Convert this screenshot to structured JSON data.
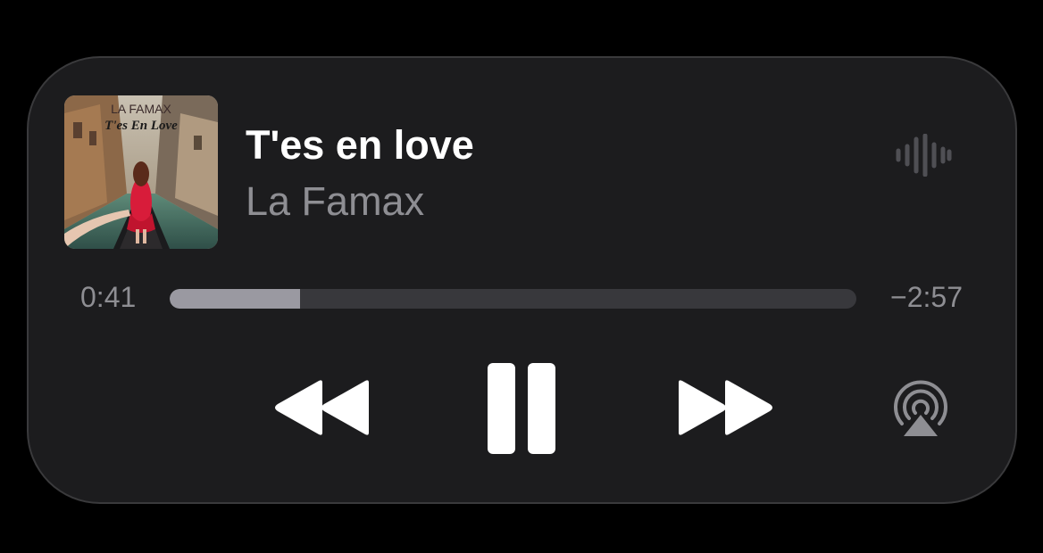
{
  "now_playing": {
    "artwork": {
      "artist_text": "LA FAMAX",
      "title_text": "T'es En Love"
    },
    "title": "T'es en love",
    "artist": "La Famax",
    "progress": {
      "elapsed": "0:41",
      "remaining": "−2:57",
      "fraction": 0.19
    }
  },
  "controls": {
    "rewind_icon": "backward-icon",
    "pause_icon": "pause-icon",
    "forward_icon": "forward-icon",
    "airplay_icon": "airplay-icon",
    "waveform_icon": "waveform-icon"
  },
  "colors": {
    "background": "#000000",
    "panel": "#1c1c1e",
    "primary_text": "#ffffff",
    "secondary_text": "#8e8e93",
    "progress_fill": "#9a99a1",
    "progress_track": "#38383c"
  }
}
